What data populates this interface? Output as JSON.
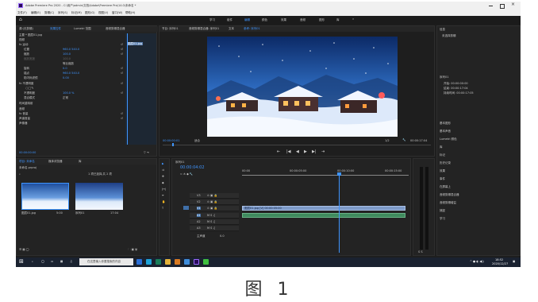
{
  "window": {
    "title": "Adobe Premiere Pro 2020 - C:\\用户\\admin\\文档\\Adobe\\Premiere Pro\\14.0\\未命名 *"
  },
  "menu": [
    "文件(F)",
    "编辑(E)",
    "剪辑(C)",
    "序列(S)",
    "标记(M)",
    "图形(G)",
    "视图(V)",
    "窗口(W)",
    "帮助(H)"
  ],
  "workspaces": [
    "学习",
    "组件",
    "编辑",
    "颜色",
    "效果",
    "音频",
    "图形",
    "库"
  ],
  "effect_controls": {
    "tabs": [
      "源:(无剪辑)",
      "效果控件",
      "Lumetri 范围",
      "音频剪辑混合器"
    ],
    "header": "主要 * 图层01.jpg",
    "clip_label": "图层01.jpg",
    "section_video": "视频",
    "rows": [
      {
        "label": "fx 运动",
        "value": ""
      },
      {
        "label": "位置",
        "value": "960.0   540.0"
      },
      {
        "label": "缩放",
        "value": "100.0"
      },
      {
        "label": "缩放宽度",
        "value": "100.0"
      },
      {
        "label": "",
        "value": "等比缩放"
      },
      {
        "label": "旋转",
        "value": "0.0"
      },
      {
        "label": "锚点",
        "value": "960.0   540.0"
      },
      {
        "label": "防闪烁滤镜",
        "value": "0.00"
      },
      {
        "label": "fx 不透明度",
        "value": ""
      },
      {
        "label": "不透明度",
        "value": "100.0 %"
      },
      {
        "label": "混合模式",
        "value": "正常"
      },
      {
        "label": "时间重映射",
        "value": ""
      },
      {
        "label": "音频",
        "value": ""
      },
      {
        "label": "fx 音量",
        "value": ""
      },
      {
        "label": "声道音量",
        "value": ""
      },
      {
        "label": "声像器",
        "value": ""
      }
    ],
    "clip_box": "图层01.jpg",
    "timecode": "00:00:00:00"
  },
  "program": {
    "tabs": [
      "节目: 序列01",
      "音频剪辑混合器: 序列01",
      "文本",
      "参考: 序列01"
    ],
    "timecode_left": "00:00:00:01",
    "fit": "适合",
    "quality": "1/2",
    "timecode_right": "00:00:17:04"
  },
  "right_panel": {
    "header": "信息",
    "sub": "未选择剪辑",
    "section_title": "序列01",
    "items": [
      "信息",
      "基本图形",
      "基本声音",
      "Lumetri 颜色",
      "库",
      "标记",
      "历史记录",
      "效果",
      "事件",
      "在屏幕上",
      "音频剪辑混合器",
      "音频剪辑增益",
      "捕捉",
      "学习"
    ],
    "timecodes": [
      "开始: 00:00:00:00",
      "结束: 00:00:17:04",
      "持续时间: 00:00:17:05"
    ]
  },
  "project": {
    "tabs": [
      "项目: 未命名",
      "媒体浏览器",
      "库"
    ],
    "file": "未命名.prproj",
    "count": "1 项已选择,共 2 项",
    "items": [
      {
        "name": "图层01.jpg",
        "duration": "5:00"
      },
      {
        "name": "序列01",
        "duration": "17:04"
      }
    ]
  },
  "timeline": {
    "tab": "序列01",
    "timecode": "00:00:04:02",
    "ruler": [
      "00:00",
      "00:00:05:00",
      "00:00:10:00",
      "00:00:15:00"
    ],
    "video_tracks": [
      "V3",
      "V2",
      "V1"
    ],
    "audio_tracks": [
      "A1",
      "A2",
      "A3"
    ],
    "master": "主声道",
    "master_value": "0.0",
    "clip_v1": "图层01.jpg [V] 00:00:05:00",
    "clip_a1": ""
  },
  "taskbar": {
    "search": "在这里输入你要搜索的内容",
    "time": "18:52",
    "date": "2020/12/27"
  },
  "caption": "图 1",
  "colors": {
    "accent": "#3f95ff",
    "panel": "#232323",
    "bg": "#1e1e1e"
  }
}
